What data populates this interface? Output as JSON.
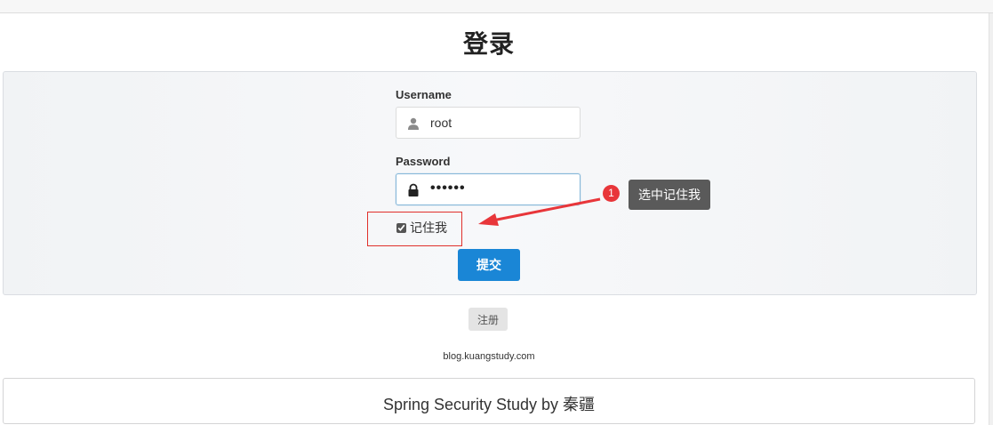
{
  "page": {
    "title": "登录"
  },
  "form": {
    "username_label": "Username",
    "username_value": "root",
    "password_label": "Password",
    "password_display": "••••••",
    "remember_label": "记住我",
    "remember_checked": true,
    "submit_label": "提交"
  },
  "register": {
    "label": "注册"
  },
  "site": {
    "link_text": "blog.kuangstudy.com"
  },
  "footer": {
    "text": "Spring Security Study by 秦疆"
  },
  "annotation": {
    "step_number": "1",
    "tooltip_text": "选中记住我",
    "highlight_color": "#e0302b",
    "arrow_color": "#e8363a"
  },
  "colors": {
    "primary_button": "#1a86d6",
    "panel_background": "#f3f5f7",
    "tooltip_background": "#5a5a5a"
  },
  "icons": {
    "username_icon": "user-icon",
    "password_icon": "lock-icon"
  }
}
